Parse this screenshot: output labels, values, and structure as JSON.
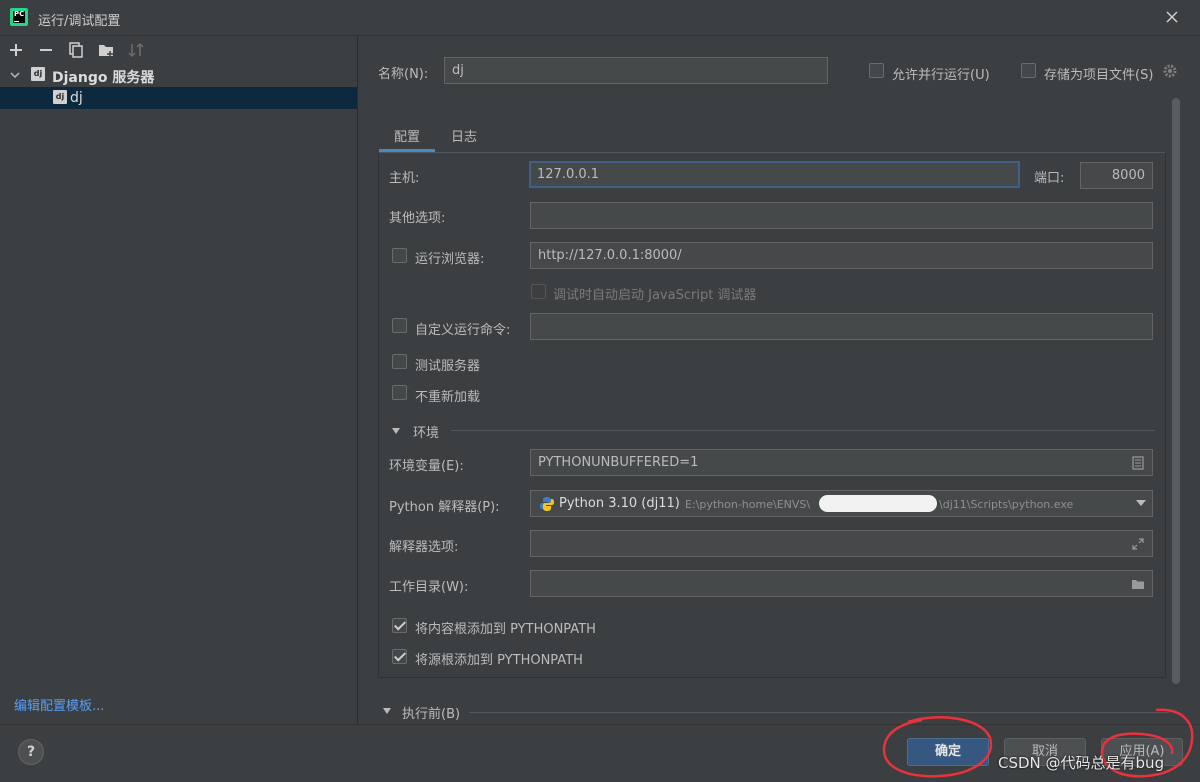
{
  "window": {
    "title": "运行/调试配置"
  },
  "tree": {
    "group_label": "Django 服务器",
    "item_label": "dj",
    "icon_text": "dj"
  },
  "left": {
    "edit_templates_link": "编辑配置模板..."
  },
  "config": {
    "name_label": "名称(N):",
    "name_value": "dj",
    "allow_parallel_label": "允许并行运行(U)",
    "store_as_project_label": "存储为项目文件(S)"
  },
  "tabs": [
    {
      "label": "配置"
    },
    {
      "label": "日志"
    }
  ],
  "form": {
    "host_label": "主机:",
    "host_value": "127.0.0.1",
    "port_label": "端口:",
    "port_value": "8000",
    "other_options_label": "其他选项:",
    "other_options_value": "",
    "run_browser_label": "运行浏览器:",
    "run_browser_value": "http://127.0.0.1:8000/",
    "js_debug_label": "调试时自动启动 JavaScript 调试器",
    "custom_run_label": "自定义运行命令:",
    "custom_run_value": "",
    "test_server_label": "测试服务器",
    "no_reload_label": "不重新加载",
    "env_section": "环境",
    "env_vars_label": "环境变量(E):",
    "env_vars_value": "PYTHONUNBUFFERED=1",
    "interpreter_label": "Python 解释器(P):",
    "interpreter_name": "Python 3.10 (dj11)",
    "interpreter_path_prefix": "E:\\python-home\\ENVS\\",
    "interpreter_path_suffix": "\\dj11\\Scripts\\python.exe",
    "interpreter_options_label": "解释器选项:",
    "interpreter_options_value": "",
    "working_dir_label": "工作目录(W):",
    "working_dir_value": "",
    "add_content_roots_label": "将内容根添加到 PYTHONPATH",
    "add_source_roots_label": "将源根添加到 PYTHONPATH",
    "before_launch_section": "执行前(B)"
  },
  "buttons": {
    "help": "?",
    "ok": "确定",
    "cancel": "取消",
    "apply": "应用(A)"
  },
  "watermark": "CSDN @代码总是有bug",
  "colors": {
    "accent": "#4a88c7",
    "primary_button": "#365880",
    "link": "#589df6",
    "annotation": "#e8323c"
  }
}
